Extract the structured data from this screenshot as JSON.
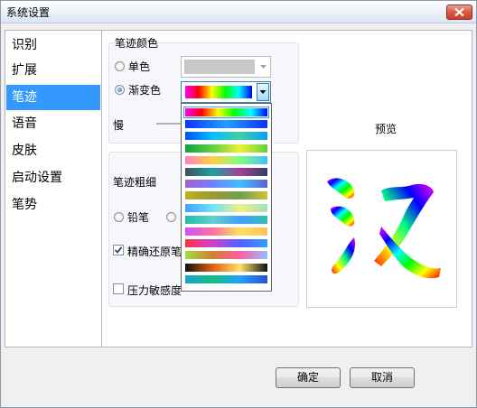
{
  "window": {
    "title": "系统设置",
    "close_icon": "close-x-icon",
    "close_color": "#d9573f"
  },
  "sidebar": {
    "selected_index": 2,
    "items": [
      {
        "label": "识别"
      },
      {
        "label": "扩展"
      },
      {
        "label": "笔迹"
      },
      {
        "label": "语音"
      },
      {
        "label": "皮肤"
      },
      {
        "label": "启动设置"
      },
      {
        "label": "笔势"
      }
    ]
  },
  "pen_color": {
    "group_label": "笔迹颜色",
    "single_label": "单色",
    "gradient_label": "渐变色",
    "selected": "gradient",
    "single_color": "#c8c8c8",
    "speed_label": "慢"
  },
  "pen_size": {
    "group_label": "笔迹粗细",
    "pencil_label": "铅笔",
    "precise_restore_label": "精确还原笔",
    "precise_restore_checked": true,
    "pressure_label": "压力敏感度",
    "pressure_checked": false
  },
  "gradient_options": [
    {
      "colors": [
        "#ff00ff",
        "#ff0000",
        "#ffff00",
        "#00ff00",
        "#00ffff",
        "#0000ff"
      ]
    },
    {
      "colors": [
        "#1030ff",
        "#20a0ff",
        "#1030ff"
      ]
    },
    {
      "colors": [
        "#0050ff",
        "#00c0ff",
        "#40d0a0",
        "#00a0ff"
      ]
    },
    {
      "colors": [
        "#10a040",
        "#60d040",
        "#f0f030",
        "#60d040"
      ]
    },
    {
      "colors": [
        "#ff80c0",
        "#ffd040",
        "#80ff80",
        "#40c0ff"
      ]
    },
    {
      "colors": [
        "#405060",
        "#20a0a0",
        "#a040a0",
        "#304060"
      ]
    },
    {
      "colors": [
        "#a060d0",
        "#7080ff",
        "#40c0ff",
        "#6060d0"
      ]
    },
    {
      "colors": [
        "#c0b020",
        "#9a9a30",
        "#70a050",
        "#d0c040"
      ]
    },
    {
      "colors": [
        "#40a0ff",
        "#70e0ff",
        "#f0f080",
        "#a0e0c0"
      ]
    },
    {
      "colors": [
        "#20c0a0",
        "#60d0d0",
        "#40a0ff",
        "#30c0b0"
      ]
    },
    {
      "colors": [
        "#d050ff",
        "#ff70a0",
        "#ffe060",
        "#ffc060"
      ]
    },
    {
      "colors": [
        "#ff3040",
        "#d040d0",
        "#5060ff",
        "#30a0ff"
      ]
    },
    {
      "colors": [
        "#a0e040",
        "#d08030",
        "#ff60a0",
        "#90c0ff"
      ]
    },
    {
      "colors": [
        "#101010",
        "#e06010",
        "#ffe070",
        "#101010"
      ]
    },
    {
      "colors": [
        "#20a0d0",
        "#10c080",
        "#20a0ff",
        "#3050d0"
      ]
    }
  ],
  "preview": {
    "label": "预览",
    "glyph": "汉"
  },
  "footer": {
    "ok_label": "确定",
    "cancel_label": "取消"
  }
}
